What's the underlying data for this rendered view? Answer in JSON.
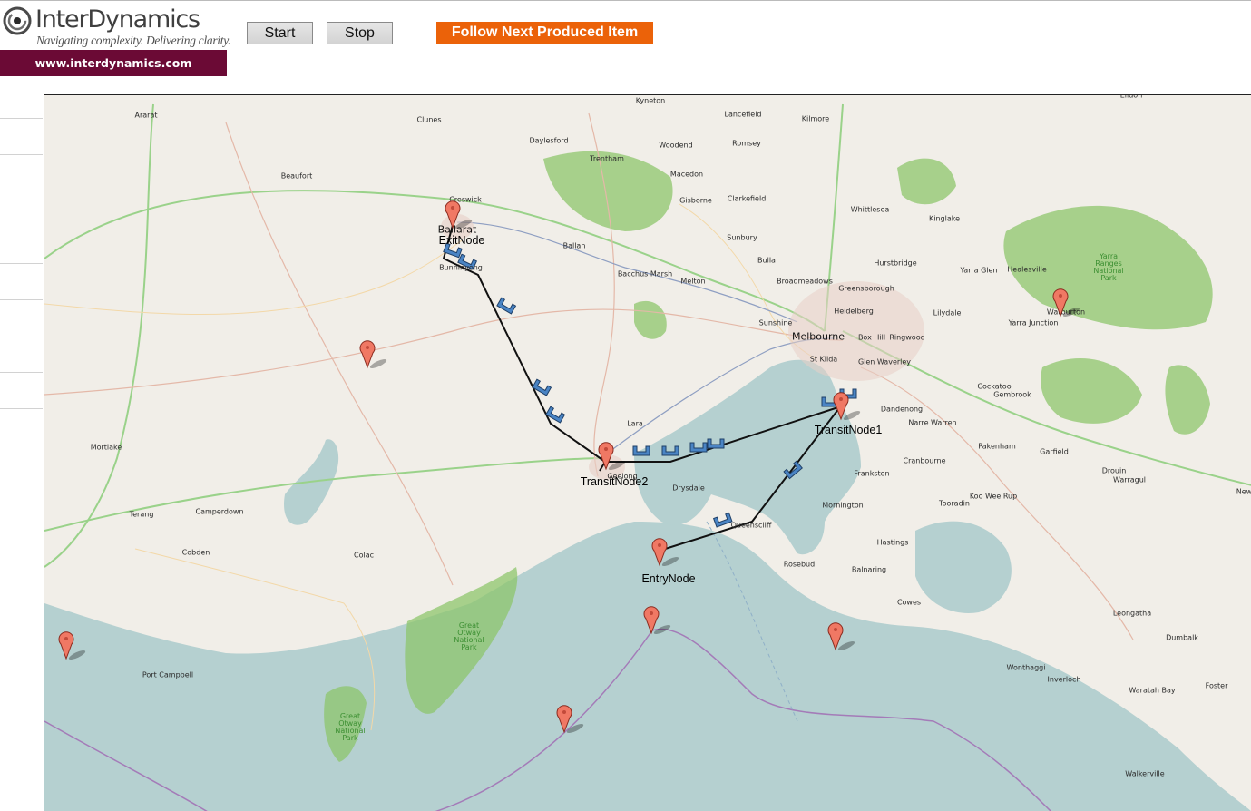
{
  "header": {
    "logo_name": "InterDynamics",
    "logo_tagline": "Navigating complexity. Delivering clarity.",
    "logo_url": "www.interdynamics.com",
    "brand_color": "#6b0a35"
  },
  "toolbar": {
    "start_label": "Start",
    "stop_label": "Stop",
    "follow_label": "Follow Next Produced Item",
    "follow_color": "#eb6209"
  },
  "map": {
    "colors": {
      "land": "#f1eee8",
      "sea": "#b5d0d0",
      "park": "#8dc56c",
      "route_line": "#111111",
      "item": "#4a84c4",
      "marker": "#f07864"
    },
    "places": [
      {
        "name": "Ararat"
      },
      {
        "name": "Clunes"
      },
      {
        "name": "Kyneton"
      },
      {
        "name": "Lancefield"
      },
      {
        "name": "Kilmore"
      },
      {
        "name": "Daylesford"
      },
      {
        "name": "Woodend"
      },
      {
        "name": "Romsey"
      },
      {
        "name": "Creswick"
      },
      {
        "name": "Trentham"
      },
      {
        "name": "Macedon"
      },
      {
        "name": "Beaufort"
      },
      {
        "name": "Gisborne"
      },
      {
        "name": "Clarkefield"
      },
      {
        "name": "Whittlesea"
      },
      {
        "name": "Kinglake"
      },
      {
        "name": "Sunbury"
      },
      {
        "name": "Ballan"
      },
      {
        "name": "Bulla"
      },
      {
        "name": "Hurstbridge"
      },
      {
        "name": "Yarra Glen"
      },
      {
        "name": "Healesville"
      },
      {
        "name": "Bacchus Marsh"
      },
      {
        "name": "Melton"
      },
      {
        "name": "Broadmeadows"
      },
      {
        "name": "Greensborough"
      },
      {
        "name": "Bunninyong"
      },
      {
        "name": "Heidelberg"
      },
      {
        "name": "Lilydale"
      },
      {
        "name": "Yarra Junction"
      },
      {
        "name": "Warburton"
      },
      {
        "name": "Sunshine"
      },
      {
        "name": "Melbourne"
      },
      {
        "name": "Box Hill"
      },
      {
        "name": "Ringwood"
      },
      {
        "name": "St Kilda"
      },
      {
        "name": "Glen Waverley"
      },
      {
        "name": "Cockatoo"
      },
      {
        "name": "Gembrook"
      },
      {
        "name": "Dandenong"
      },
      {
        "name": "Narre Warren"
      },
      {
        "name": "Lara"
      },
      {
        "name": "Mortlake"
      },
      {
        "name": "Pakenham"
      },
      {
        "name": "Garfield"
      },
      {
        "name": "Frankston"
      },
      {
        "name": "Cranbourne"
      },
      {
        "name": "Drouin"
      },
      {
        "name": "Warragul"
      },
      {
        "name": "Drysdale"
      },
      {
        "name": "Koo Wee Rup"
      },
      {
        "name": "Mornington"
      },
      {
        "name": "Tooradin"
      },
      {
        "name": "Terang"
      },
      {
        "name": "Camperdown"
      },
      {
        "name": "Queenscliff"
      },
      {
        "name": "Hastings"
      },
      {
        "name": "Cobden"
      },
      {
        "name": "Colac"
      },
      {
        "name": "Rosebud"
      },
      {
        "name": "Balnaring"
      },
      {
        "name": "Cowes"
      },
      {
        "name": "Leongatha"
      },
      {
        "name": "Port Campbell"
      },
      {
        "name": "Dumbalk"
      },
      {
        "name": "Wonthaggi"
      },
      {
        "name": "Inverloch"
      },
      {
        "name": "Foster"
      },
      {
        "name": "Waratah Bay"
      },
      {
        "name": "Walkerville"
      },
      {
        "name": "Newb"
      },
      {
        "name": "Eildon"
      },
      {
        "name": "Ballarat"
      },
      {
        "name": "Geelong"
      }
    ],
    "parks": [
      {
        "name": "Great\nOtway\nNational\nPark"
      },
      {
        "name": "Great\nOtway\nNational\nPark"
      },
      {
        "name": "Yarra\nRanges\nNational\nPark"
      }
    ],
    "nodes": [
      {
        "name": "ExitNode"
      },
      {
        "name": "TransitNode2"
      },
      {
        "name": "TransitNode1"
      },
      {
        "name": "EntryNode"
      }
    ]
  }
}
